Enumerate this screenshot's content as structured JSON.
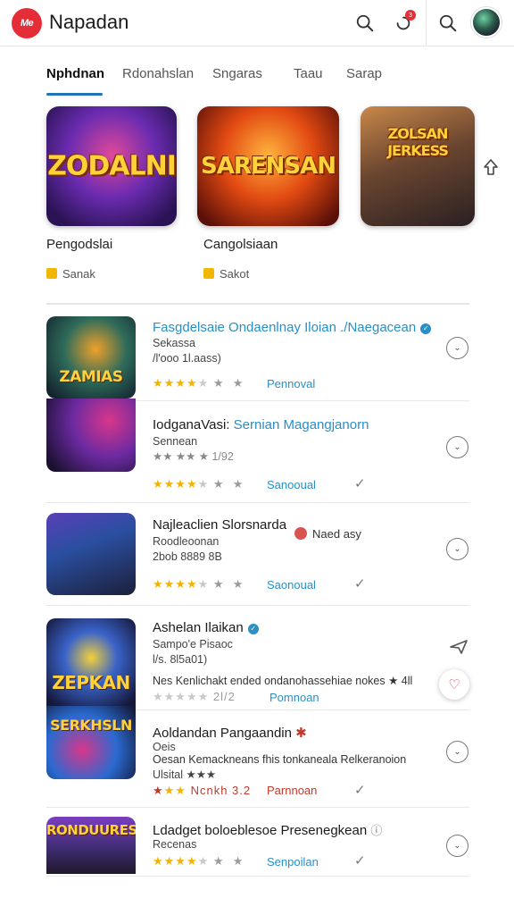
{
  "header": {
    "logo_text": "Me",
    "title": "Napadan",
    "notification_count": "3"
  },
  "tabs": [
    {
      "label": "Nphdnan",
      "active": true
    },
    {
      "label": "Rdonahslan",
      "active": false
    },
    {
      "label": "Sngaras",
      "active": false
    },
    {
      "label": "Taau",
      "active": false
    },
    {
      "label": "Sarap",
      "active": false
    }
  ],
  "featured": [
    {
      "art_text": "ZODALNI",
      "name": "Pengodslai",
      "meta": "Sanak",
      "colors": [
        "#3b1a6e",
        "#e0489a"
      ]
    },
    {
      "art_text": "SARENSAN",
      "name": "Cangolsiaan",
      "meta": "Sakot",
      "colors": [
        "#8a1d0f",
        "#f27b1b"
      ]
    },
    {
      "art_text": "ZOLSAN JERKESS",
      "name": "",
      "meta": "",
      "colors": [
        "#3a2a28",
        "#c9884a"
      ]
    }
  ],
  "list": [
    {
      "thumb_text": "ZAMIAS",
      "title_blue": "Fasgdelsaie Ondaenlnay Iloian ./Naegacean",
      "subtitle": "Sekassa",
      "detail": "/l'ooo 1l.aass)",
      "stars_on": 3,
      "stars_half": 1,
      "stars_off": 1,
      "link": "Pennoval",
      "has_check": false
    },
    {
      "thumb_text": "",
      "title_plain": "IodganaVasi:",
      "title_blue": "Sernian Magangjanorn",
      "subtitle": "Sennean",
      "detail": "★★ ★★ ★ 1/92",
      "stars_on": 3,
      "stars_half": 1,
      "stars_off": 1,
      "link": "Sanooual",
      "has_check": true
    },
    {
      "thumb_text": "",
      "title_plain": "Najleaclien Slorsnarda",
      "tag": "Naed asy",
      "subtitle": "Roodleoonan",
      "detail": "2bob  8889 8B",
      "stars_on": 3,
      "stars_half": 1,
      "stars_off": 1,
      "link": "Saonoual",
      "has_check": true
    },
    {
      "thumb_text": "ZEPKAN",
      "title_plain": "Ashelan Ilaikan",
      "subtitle": "Sampo'e  Pisaoc",
      "detail": "l/s. 8l5a01)",
      "desc": "Nes Kenlichakt ended ondanohassehiae nokes ★ 4ll",
      "stars_on": 0,
      "stars_half": 0,
      "stars_off": 5,
      "rating_text": "2l/2",
      "link": "Pomnoan",
      "has_check": false
    },
    {
      "thumb_text": "SERKHSLN",
      "title_plain": "Aoldandan Pangaandin",
      "subtitle": "Oeis",
      "desc": "Oesan Kemackneans fhis tonkaneala Relkeranoion",
      "detail": "Ulsital ★★★",
      "stars_on": 3,
      "stars_half": 0,
      "stars_off": 0,
      "rating_text": "Ncnkh 3.2",
      "link": "Parnnoan",
      "link_red": true,
      "has_check": true
    },
    {
      "thumb_text": "RONDUURES",
      "title_plain": "Ldadget boloeblesoe Presenegkean",
      "subtitle": "Recenas",
      "stars_on": 3,
      "stars_half": 1,
      "stars_off": 1,
      "link": "Senpoilan",
      "has_check": true
    }
  ],
  "colors": {
    "accent": "#1f73b7",
    "link": "#2a8fc7",
    "brand_red": "#e52d38",
    "star": "#f5b301"
  }
}
